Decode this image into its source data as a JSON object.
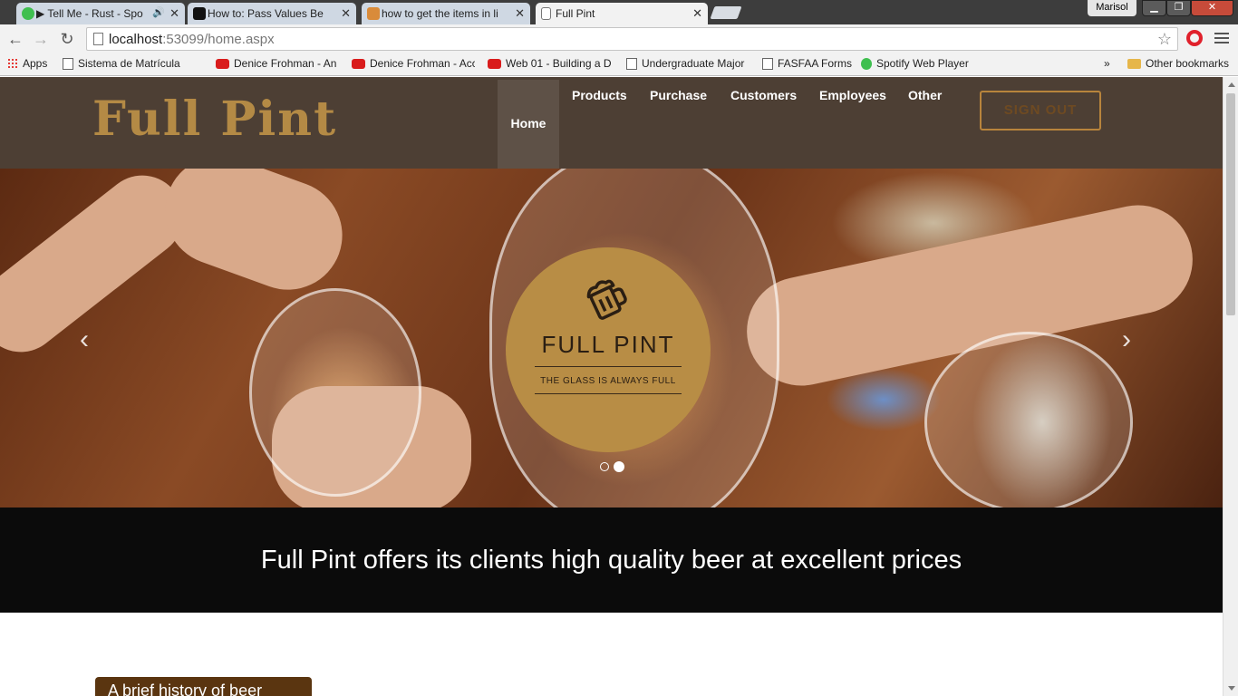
{
  "browser": {
    "tabs": [
      {
        "title": "▶ Tell Me - Rust - Spo",
        "favicon": "spotify-icon",
        "active": false
      },
      {
        "title": "How to: Pass Values Betw",
        "favicon": "m-icon",
        "active": false
      },
      {
        "title": "how to get the items in lis",
        "favicon": "stack-icon",
        "active": false
      },
      {
        "title": "Full Pint",
        "favicon": "page-icon",
        "active": true
      }
    ],
    "user_name": "Marisol",
    "address": {
      "host": "localhost",
      "rest": ":53099/home.aspx"
    },
    "bookmarks": [
      {
        "label": "Apps",
        "icon": "apps-icon"
      },
      {
        "label": "Sistema de Matrícula",
        "icon": "page-icon"
      },
      {
        "label": "Denice Frohman - An",
        "icon": "youtube-icon"
      },
      {
        "label": "Denice Frohman - Acc",
        "icon": "youtube-icon"
      },
      {
        "label": "Web 01 - Building a D",
        "icon": "youtube-icon"
      },
      {
        "label": "Undergraduate Major",
        "icon": "page-icon"
      },
      {
        "label": "FASFAA Forms",
        "icon": "page-icon"
      },
      {
        "label": "Spotify Web Player",
        "icon": "spotify-icon"
      }
    ],
    "bookmarks_overflow": "»",
    "other_bookmarks": "Other bookmarks"
  },
  "site": {
    "logo": "Full Pint",
    "nav": {
      "home": "Home",
      "products": "Products",
      "purchase": "Purchase",
      "customers": "Customers",
      "employees": "Employees",
      "other": "Other"
    },
    "sign_out": "SIGN OUT",
    "hero": {
      "brand": "FULL PINT",
      "tagline": "THE GLASS IS ALWAYS FULL",
      "prev": "‹",
      "next": "›",
      "slide_count": 2,
      "active_slide": 2
    },
    "tagline_band": "Full Pint offers its clients high quality beer at excellent prices",
    "history_heading": "A brief history of beer"
  },
  "colors": {
    "header_bg": "#4d3f34",
    "accent_gold": "#b88d45",
    "band_bg": "#0b0b0b",
    "history_tab": "#5a3510"
  }
}
